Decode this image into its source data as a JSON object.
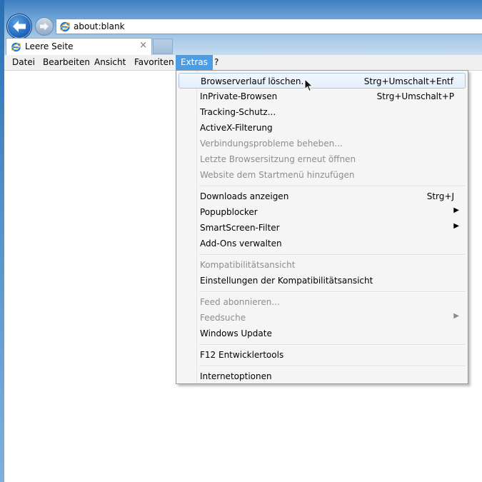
{
  "browser": {
    "address": "about:blank",
    "tab_label": "Leere Seite",
    "tab_close": "×"
  },
  "menubar": {
    "items": [
      {
        "label": "Datei"
      },
      {
        "label": "Bearbeiten"
      },
      {
        "label": "Ansicht"
      },
      {
        "label": "Favoriten"
      },
      {
        "label": "Extras"
      },
      {
        "label": "?"
      }
    ],
    "active": "Extras"
  },
  "extras_menu": {
    "items": [
      {
        "label": "Browserverlauf löschen...",
        "shortcut": "Strg+Umschalt+Entf",
        "state": "hover"
      },
      {
        "label": "InPrivate-Browsen",
        "shortcut": "Strg+Umschalt+P"
      },
      {
        "label": "Tracking-Schutz..."
      },
      {
        "label": "ActiveX-Filterung"
      },
      {
        "label": "Verbindungsprobleme beheben...",
        "state": "disabled"
      },
      {
        "label": "Letzte Browsersitzung erneut öffnen",
        "state": "disabled"
      },
      {
        "label": "Website dem Startmenü hinzufügen",
        "state": "disabled"
      },
      {
        "label": "Downloads anzeigen",
        "shortcut": "Strg+J"
      },
      {
        "label": "Popupblocker",
        "submenu": true
      },
      {
        "label": "SmartScreen-Filter",
        "submenu": true
      },
      {
        "label": "Add-Ons verwalten"
      },
      {
        "label": "Kompatibilitätsansicht",
        "state": "disabled"
      },
      {
        "label": "Einstellungen der Kompatibilitätsansicht"
      },
      {
        "label": "Feed abonnieren...",
        "state": "disabled"
      },
      {
        "label": "Feedsuche",
        "submenu": true,
        "state": "disabled"
      },
      {
        "label": "Windows Update"
      },
      {
        "label": "F12 Entwicklertools"
      },
      {
        "label": "Internetoptionen"
      }
    ],
    "submenu_arrow": "▶"
  },
  "icons": {
    "back": "back-arrow-icon",
    "forward": "forward-arrow-icon",
    "ie": "internet-explorer-icon",
    "cursor": "mouse-pointer-icon"
  },
  "colors": {
    "menu_highlight": "#4a9ee8",
    "title_blue": "#3f7fbf"
  }
}
